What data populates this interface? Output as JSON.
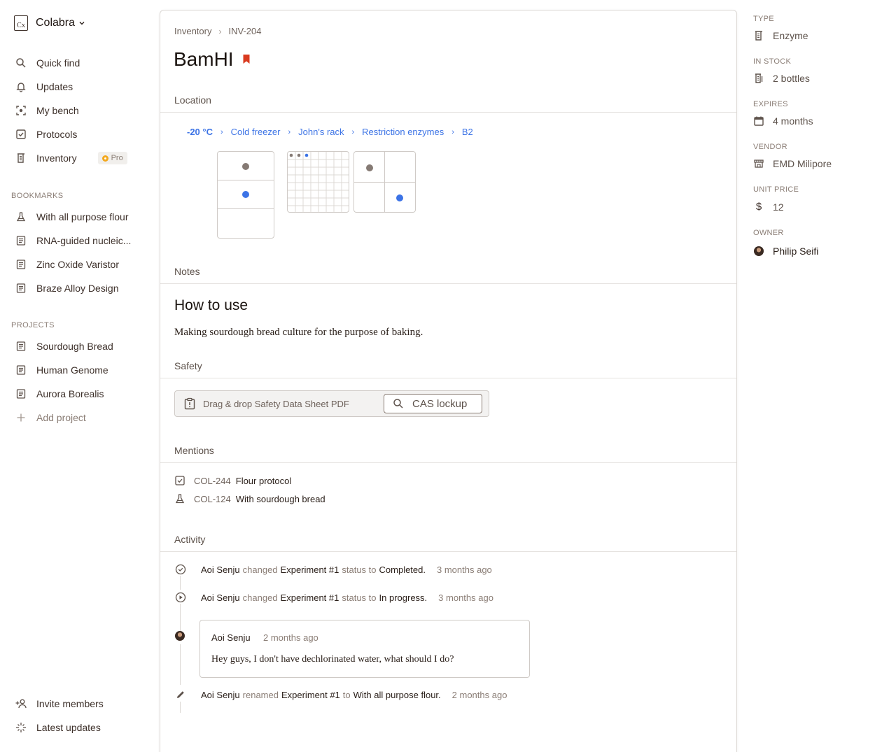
{
  "workspace": {
    "name": "Colabra",
    "logo_text": "Cx"
  },
  "nav": [
    {
      "label": "Quick find",
      "icon": "search-icon"
    },
    {
      "label": "Updates",
      "icon": "bell-icon"
    },
    {
      "label": "My bench",
      "icon": "focus-icon"
    },
    {
      "label": "Protocols",
      "icon": "checkbox-icon"
    },
    {
      "label": "Inventory",
      "icon": "inventory-icon",
      "badge": "Pro"
    }
  ],
  "bookmarks": {
    "title": "BOOKMARKS",
    "items": [
      {
        "label": "With all purpose flour",
        "icon": "flask-icon"
      },
      {
        "label": "RNA-guided nucleic...",
        "icon": "document-icon"
      },
      {
        "label": "Zinc Oxide Varistor",
        "icon": "document-icon"
      },
      {
        "label": "Braze Alloy Design",
        "icon": "document-icon"
      }
    ]
  },
  "projects": {
    "title": "PROJECTS",
    "items": [
      {
        "label": "Sourdough Bread",
        "icon": "document-icon"
      },
      {
        "label": "Human Genome",
        "icon": "document-icon"
      },
      {
        "label": "Aurora Borealis",
        "icon": "document-icon"
      }
    ],
    "add_label": "Add project"
  },
  "footer": {
    "invite": "Invite members",
    "latest": "Latest updates"
  },
  "breadcrumb": [
    "Inventory",
    "INV-204"
  ],
  "item": {
    "title": "BamHI",
    "bookmark_color": "#d93a1f"
  },
  "location": {
    "label": "Location",
    "path": [
      "-20 °C",
      "Cold freezer",
      "John's rack",
      "Restriction enzymes",
      "B2"
    ]
  },
  "notes": {
    "label": "Notes",
    "heading": "How to use",
    "body": "Making sourdough bread culture for the purpose of baking."
  },
  "safety": {
    "label": "Safety",
    "dropzone": "Drag & drop Safety Data Sheet PDF",
    "cas_button": "CAS lockup"
  },
  "mentions": {
    "label": "Mentions",
    "items": [
      {
        "id": "COL-244",
        "title": "Flour protocol",
        "icon": "checkbox-icon"
      },
      {
        "id": "COL-124",
        "title": "With sourdough bread",
        "icon": "flask-icon"
      }
    ]
  },
  "activity": {
    "label": "Activity",
    "events": [
      {
        "icon": "check-circle-icon",
        "user": "Aoi Senju",
        "verb": "changed",
        "object": "Experiment #1",
        "mid": "status to",
        "value": "Completed.",
        "time": "3 months ago"
      },
      {
        "icon": "play-circle-icon",
        "user": "Aoi Senju",
        "verb": "changed",
        "object": "Experiment #1",
        "mid": "status to",
        "value": "In progress.",
        "time": "3 months ago"
      },
      {
        "icon": "avatar",
        "user": "Aoi Senju",
        "time": "2 months ago",
        "comment": "Hey guys, I don't have dechlorinated water, what should I do?"
      },
      {
        "icon": "pencil-icon",
        "user": "Aoi Senju",
        "verb": "renamed",
        "object": "Experiment #1",
        "mid": "to",
        "value": "With all purpose flour.",
        "time": "2 months ago"
      }
    ]
  },
  "properties": {
    "type": {
      "label": "TYPE",
      "value": "Enzyme"
    },
    "in_stock": {
      "label": "IN STOCK",
      "value": "2 bottles"
    },
    "expires": {
      "label": "EXPIRES",
      "value": "4 months"
    },
    "vendor": {
      "label": "VENDOR",
      "value": "EMD Milipore"
    },
    "unit_price": {
      "label": "UNIT PRICE",
      "value": "12"
    },
    "owner": {
      "label": "OWNER",
      "value": "Philip Seifi"
    }
  },
  "colors": {
    "accent_blue": "#3c73e6",
    "bookmark_red": "#d93a1f",
    "pro_badge": "#f3a81d"
  }
}
